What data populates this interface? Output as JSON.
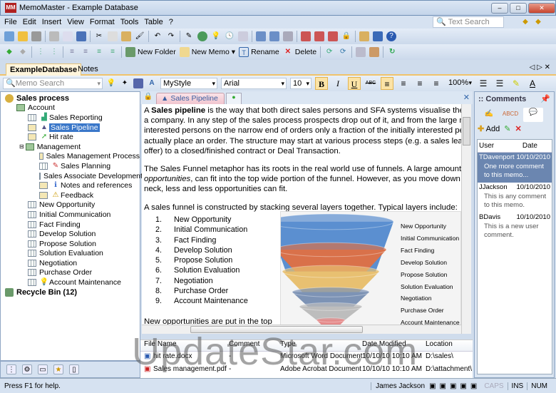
{
  "window": {
    "title": "MemoMaster - Example Database",
    "logo": "MM"
  },
  "menu": [
    "File",
    "Edit",
    "Insert",
    "View",
    "Format",
    "Tools",
    "Table",
    "?"
  ],
  "text_search": {
    "placeholder": "Text Search"
  },
  "toolbar2": {
    "new_folder": "New Folder",
    "new_memo": "New Memo",
    "rename": "Rename",
    "delete": "Delete"
  },
  "db_tabs": [
    "ExampleDatabase",
    "Notes"
  ],
  "format": {
    "memo_search_placeholder": "Memo Search",
    "style": "MyStyle",
    "font": "Arial",
    "size": "10",
    "bold": "B",
    "italic": "I",
    "underline": "U",
    "strike": "ABC",
    "zoom": "100%"
  },
  "tree": {
    "root": "Sales process",
    "account": "Account",
    "account_items": [
      "Sales Reporting",
      "Sales Pipeline",
      "Hit rate"
    ],
    "management": "Management",
    "management_items": [
      "Sales Management Process",
      "Sales Planning",
      "Sales Associate Development",
      "Notes and references",
      "Feedback"
    ],
    "steps": [
      "New Opportunity",
      "Initial Communication",
      "Fact Finding",
      "Develop Solution",
      "Propose Solution",
      "Solution Evaluation",
      "Negotiation",
      "Purchase Order",
      "Account Maintenance"
    ],
    "recycle": "Recycle Bin (12)"
  },
  "editor": {
    "tab": "Sales Pipeline",
    "p1_a": "A ",
    "p1_bold": "Sales pipeline",
    "p1_b": " is the way that both direct sales persons and SFA systems visualise the",
    "p1_lines": [
      "a company. In any step of the sales process prospects drop out of it, and from the large n",
      "interested persons on the narrow end of orders only a fraction of the initially interested pe",
      "actually place an order. The structure may start at various process steps (e.g. a sales lea",
      "offer) to a closed/finished contract or Deal Transaction."
    ],
    "p2_a": "The Sales Funnel metaphor has its roots in the real world use of funnels. A large amount",
    "p2_italic": "opportunities",
    "p2_b": ", can fit into the top wide portion of the funnel. However, as you move down t",
    "p2_c": "neck, less and less opportunities can fit.",
    "p3": "A sales funnel is constructed by stacking several layers together. Typical layers include:",
    "list": [
      "New Opportunity",
      "Initial Communication",
      "Fact Finding",
      "Develop Solution",
      "Propose Solution",
      "Solution Evaluation",
      "Negotiation",
      "Purchase Order",
      "Account Maintenance"
    ],
    "p4": "New opportunities are put in the top"
  },
  "funnel": {
    "labels": [
      "New Opportunity",
      "Initial Communication",
      "Fact Finding",
      "Develop Solution",
      "Propose Solution",
      "Solution Evaluation",
      "Negotiation",
      "Purchase Order",
      "Account Maintenance"
    ],
    "colors": [
      "#5b8fd0",
      "#d9714a",
      "#e8c071",
      "#7d93b5",
      "#bdbdbd",
      "#e58a8a"
    ]
  },
  "attachments": {
    "headers": [
      "File Name",
      "Comment",
      "Type",
      "Date Modified",
      "Location"
    ],
    "rows": [
      [
        "hit rate.docx",
        "-",
        "Microsoft Word Document",
        "10/10/10 10:10 AM",
        "D:\\sales\\"
      ],
      [
        "Sales management.pdf",
        "-",
        "Adobe Acrobat Document",
        "10/10/10 10:10 AM",
        "D:\\attachment\\"
      ]
    ]
  },
  "comments": {
    "title": ":: Comments",
    "add": "Add",
    "headers": [
      "User",
      "Date"
    ],
    "items": [
      {
        "user": "TDavenport",
        "date": "10/10/2010",
        "text": "One more comment to this memo..."
      },
      {
        "user": "JJackson",
        "date": "10/10/2010",
        "text": "This is any comment to this memo."
      },
      {
        "user": "BDavis",
        "date": "10/10/2010",
        "text": "This is a new user comment."
      }
    ]
  },
  "status": {
    "help": "Press F1 for help.",
    "user": "James Jackson",
    "caps": "CAPS",
    "ins": "INS",
    "num": "NUM"
  },
  "watermark": "UpdateStar.com"
}
